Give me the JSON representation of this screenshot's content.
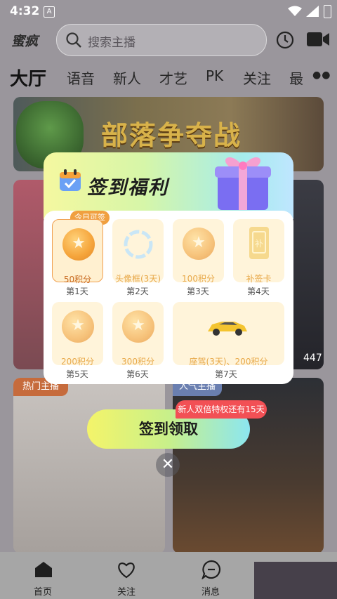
{
  "status_bar": {
    "time": "4:32",
    "notif_icon": "A"
  },
  "header": {
    "logo": "蜜疯",
    "search_placeholder": "搜索主播"
  },
  "tabs": [
    "大厅",
    "语音",
    "新人",
    "才艺",
    "PK",
    "关注",
    "最"
  ],
  "banner": {
    "text": "部落争夺战"
  },
  "cards": {
    "card2_count": "447",
    "card3_badge": "热门主播",
    "card4_badge": "人气主播"
  },
  "popup": {
    "title": "签到福利",
    "today_tag": "今日可签",
    "days": [
      {
        "reward": "50积分",
        "label": "第1天",
        "state": "today"
      },
      {
        "reward": "头像框(3天)",
        "label": "第2天"
      },
      {
        "reward": "100积分",
        "label": "第3天"
      },
      {
        "reward": "补签卡",
        "label": "第4天"
      },
      {
        "reward": "200积分",
        "label": "第5天"
      },
      {
        "reward": "300积分",
        "label": "第6天"
      },
      {
        "reward": "座驾(3天)、200积分",
        "label": "第7天"
      }
    ]
  },
  "sign_button": "签到领取",
  "promo_tag": "新人双倍特权还有15天",
  "bottom_nav": [
    {
      "label": "首页",
      "icon": "home-icon"
    },
    {
      "label": "关注",
      "icon": "heart-icon"
    },
    {
      "label": "消息",
      "icon": "message-icon"
    }
  ],
  "colors": {
    "accent": "#f0a040",
    "promo": "#f25055"
  }
}
